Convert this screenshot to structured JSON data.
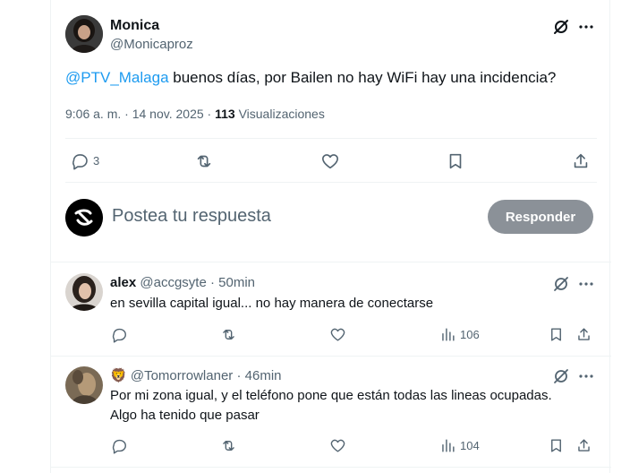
{
  "main_post": {
    "author_name": "Monica",
    "author_handle": "@Monicaproz",
    "mention": "@PTV_Malaga",
    "text": " buenos días, por Bailen no hay WiFi hay una incidencia?",
    "time": "9:06 a. m.",
    "separator": "·",
    "date": "14 nov. 2025",
    "separator2": "·",
    "views_count": "113",
    "views_label": "Visualizaciones",
    "reply_count": "3"
  },
  "composer": {
    "placeholder": "Postea tu respuesta",
    "button_label": "Responder"
  },
  "replies": [
    {
      "name": "alex",
      "handle": "@accgsyte",
      "separator": "·",
      "time": "50min",
      "text": "en sevilla capital igual... no hay manera de conectarse",
      "views": "106"
    },
    {
      "name_emoji": "🦁",
      "handle": "@Tomorrowlaner",
      "separator": "·",
      "time": "46min",
      "text_line1": "Por mi zona igual, y el teléfono pone que están todas las lineas ocupadas.",
      "text_line2": "Algo ha tenido que pasar",
      "views": "104"
    }
  ],
  "icons": {
    "grok": "grok-icon",
    "more": "more-icon",
    "reply": "reply-icon",
    "repost": "repost-icon",
    "like": "like-icon",
    "bookmark": "bookmark-icon",
    "share": "share-icon",
    "views": "views-icon"
  },
  "colors": {
    "link": "#1d9bf0",
    "text": "#0f1419",
    "muted": "#536471",
    "button_bg": "#8b9198",
    "border": "#eff3f4"
  }
}
